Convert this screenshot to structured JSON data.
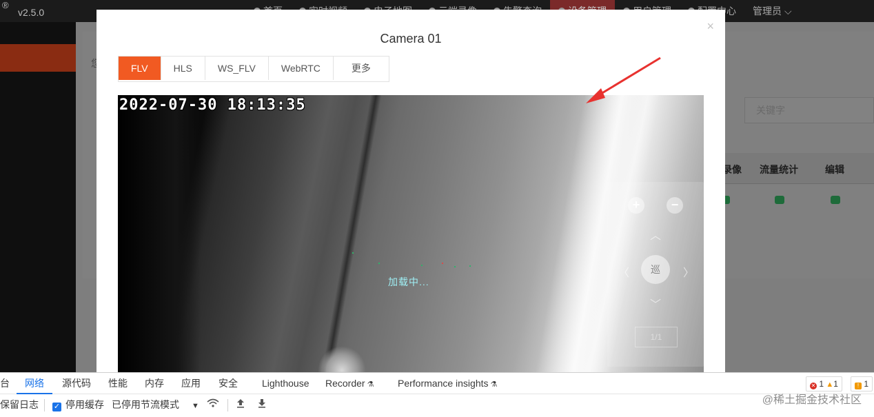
{
  "app": {
    "brand_mark": "®",
    "version": "v2.5.0",
    "nav": [
      {
        "label": "首页",
        "icon": "home-icon"
      },
      {
        "label": "实时视频",
        "icon": "play-icon"
      },
      {
        "label": "电子地图",
        "icon": "map-pin-icon"
      },
      {
        "label": "云端录像",
        "icon": "cloud-icon"
      },
      {
        "label": "告警查询",
        "icon": "bell-icon"
      },
      {
        "label": "设备管理",
        "icon": "device-icon",
        "active": true
      },
      {
        "label": "用户管理",
        "icon": "user-icon"
      },
      {
        "label": "配置中心",
        "icon": "gear-icon"
      }
    ],
    "user_menu": "管理员",
    "background_hint": "您",
    "search_placeholder": "关键字",
    "table_headers": [
      "录像",
      "流量统计",
      "编辑"
    ]
  },
  "modal": {
    "title": "Camera 01",
    "close_symbol": "×",
    "tabs": [
      {
        "label": "FLV",
        "active": true
      },
      {
        "label": "HLS",
        "active": false
      },
      {
        "label": "WS_FLV",
        "active": false
      },
      {
        "label": "WebRTC",
        "active": false
      },
      {
        "label": "更多",
        "active": false
      }
    ],
    "video": {
      "timestamp": "2022-07-30 18:13:35",
      "loading_text": "加载中...",
      "ptz": {
        "zoom_in": "+",
        "zoom_out": "−",
        "center_label": "巡",
        "speed": "1/1"
      }
    }
  },
  "devtools": {
    "tabs": [
      {
        "label": "台"
      },
      {
        "label": "网络",
        "active": true
      },
      {
        "label": "源代码"
      },
      {
        "label": "性能"
      },
      {
        "label": "内存"
      },
      {
        "label": "应用"
      },
      {
        "label": "安全"
      },
      {
        "label": "Lighthouse"
      },
      {
        "label": "Recorder",
        "experimental": true
      },
      {
        "label": "Performance insights",
        "experimental": true
      }
    ],
    "error_count": "1",
    "warning_count": "1",
    "issue_count": "1",
    "toolbar": {
      "preserve_log": "保留日志",
      "disable_cache": "停用缓存",
      "disable_cache_checked": true,
      "throttling": "已停用节流模式"
    }
  },
  "watermark": "@稀土掘金技术社区",
  "colors": {
    "accent": "#f15a22",
    "devtools_blue": "#1a73e8",
    "annotation_red": "#e8322f",
    "loading_text": "#9ff0f5"
  }
}
